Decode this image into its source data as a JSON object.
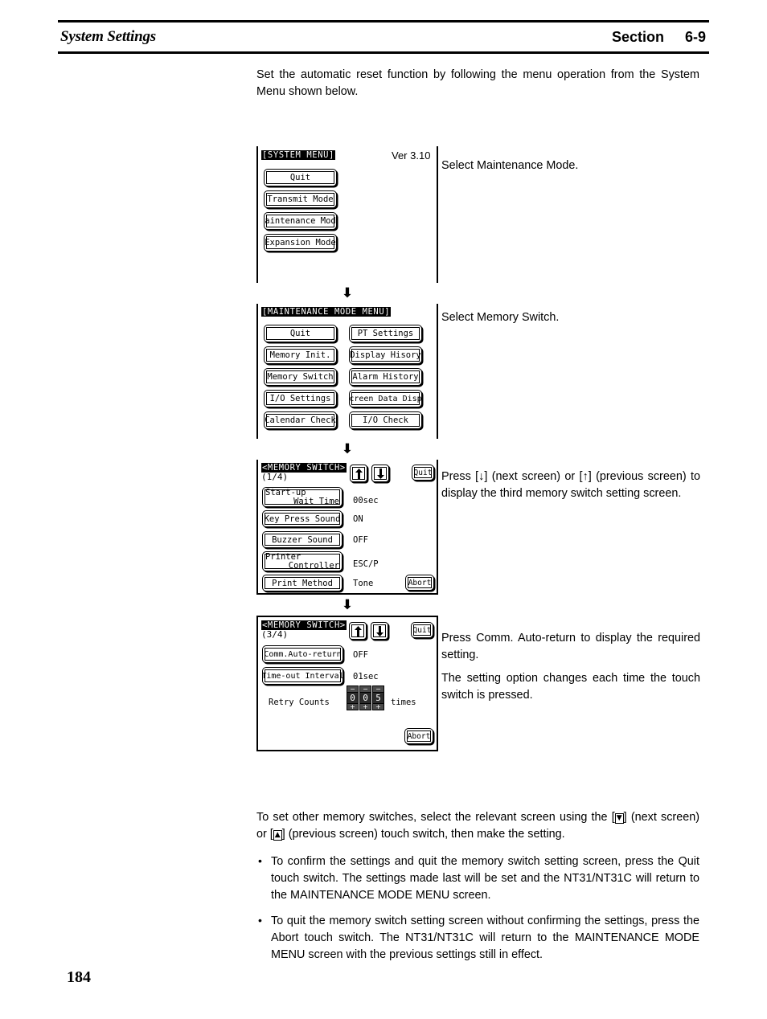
{
  "header": {
    "title": "System Settings",
    "section_label": "Section",
    "section_number": "6-9"
  },
  "intro": "Set the automatic reset function by following the menu operation from the System Menu shown below.",
  "screens": [
    {
      "id": "system-menu",
      "title": "[SYSTEM MENU]",
      "version": "Ver 3.10",
      "buttons": [
        "Quit",
        "Transmit Mode",
        "Maintenance Mode",
        "Expansion Mode"
      ],
      "note": [
        "Select Maintenance Mode."
      ]
    },
    {
      "id": "maintenance-mode-menu",
      "title": "[MAINTENANCE MODE MENU]",
      "buttons_left": [
        "Quit",
        "Memory Init.",
        "Memory Switch",
        "I/O Settings",
        "Calendar Check"
      ],
      "buttons_right": [
        "PT Settings",
        "Display Hisory",
        "Alarm History",
        "Screen Data Disp.",
        "I/O Check"
      ],
      "note": [
        "Select Memory Switch."
      ]
    },
    {
      "id": "memory-switch-1-4",
      "title": "<MEMORY SWITCH>",
      "page_indicator": "(1/4)",
      "up_icon": "arrow-up-icon",
      "down_icon": "arrow-down-icon",
      "quit_label": "Quit",
      "abort_label": "Abort",
      "rows": [
        {
          "label_line1": "Start-up",
          "label_line2": "Wait Time",
          "value": "00sec"
        },
        {
          "label_line1": "Key Press Sound",
          "label_line2": "",
          "value": "ON"
        },
        {
          "label_line1": "Buzzer Sound",
          "label_line2": "",
          "value": "OFF"
        },
        {
          "label_line1": "Printer",
          "label_line2": "Controller",
          "value": "ESC/P"
        },
        {
          "label_line1": "Print Method",
          "label_line2": "",
          "value": "Tone"
        }
      ],
      "note": [
        "Press [↓] (next screen) or [↑] (previous screen) to display the third memory switch setting screen."
      ]
    },
    {
      "id": "memory-switch-3-4",
      "title": "<MEMORY SWITCH>",
      "page_indicator": "(3/4)",
      "up_icon": "arrow-up-icon",
      "down_icon": "arrow-down-icon",
      "quit_label": "Quit",
      "abort_label": "Abort",
      "rows": [
        {
          "label_line1": "Comm.Auto-return",
          "label_line2": "",
          "value": "OFF"
        },
        {
          "label_line1": "Time-out Interval",
          "label_line2": "",
          "value": "01sec"
        }
      ],
      "retry": {
        "label": "Retry Counts",
        "digits": [
          "0",
          "0",
          "5"
        ],
        "minus_glyph": "−",
        "plus_glyph": "+",
        "unit": "times"
      },
      "note": [
        "Press Comm. Auto-return to display the required setting.",
        "The setting option changes each time the touch switch is pressed."
      ]
    }
  ],
  "bottom": {
    "paragraph_part1": "To set other memory switches, select the relevant screen using the [",
    "key_down": "▼",
    "paragraph_part2": "] (next screen) or [",
    "key_up": "▲",
    "paragraph_part3": "] (previous screen) touch switch, then make the setting.",
    "bullets": [
      "To confirm the settings and quit the memory switch setting screen, press the Quit touch switch. The settings made last will be set and the NT31/NT31C will return to the MAINTENANCE MODE MENU screen.",
      "To quit the memory switch setting screen without confirming the settings, press the Abort touch switch. The NT31/NT31C will return to the MAINTENANCE MODE MENU screen with the previous settings still in effect."
    ],
    "bullet_glyph": "•"
  },
  "page_number": "184"
}
